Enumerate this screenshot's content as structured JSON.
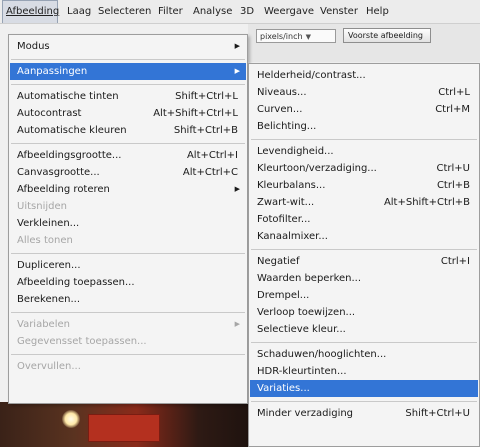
{
  "menubar": [
    {
      "label": "Afbeelding",
      "active": true
    },
    {
      "label": "Laag"
    },
    {
      "label": "Selecteren"
    },
    {
      "label": "Filter"
    },
    {
      "label": "Analyse"
    },
    {
      "label": "3D"
    },
    {
      "label": "Weergave"
    },
    {
      "label": "Venster"
    },
    {
      "label": "Help"
    }
  ],
  "toolbar": {
    "unit_field": "pixels/inch",
    "front_image_button": "Voorste afbeelding"
  },
  "main_menu": [
    {
      "label": "Modus",
      "submenu": true
    },
    {
      "separator": true
    },
    {
      "label": "Aanpassingen",
      "submenu": true,
      "highlighted": true
    },
    {
      "separator": true
    },
    {
      "label": "Automatische tinten",
      "shortcut": "Shift+Ctrl+L"
    },
    {
      "label": "Autocontrast",
      "shortcut": "Alt+Shift+Ctrl+L"
    },
    {
      "label": "Automatische kleuren",
      "shortcut": "Shift+Ctrl+B"
    },
    {
      "separator": true
    },
    {
      "label": "Afbeeldingsgrootte...",
      "shortcut": "Alt+Ctrl+I"
    },
    {
      "label": "Canvasgrootte...",
      "shortcut": "Alt+Ctrl+C"
    },
    {
      "label": "Afbeelding roteren",
      "submenu": true
    },
    {
      "label": "Uitsnijden",
      "disabled": true
    },
    {
      "label": "Verkleinen..."
    },
    {
      "label": "Alles tonen",
      "disabled": true
    },
    {
      "separator": true
    },
    {
      "label": "Dupliceren..."
    },
    {
      "label": "Afbeelding toepassen..."
    },
    {
      "label": "Berekenen..."
    },
    {
      "separator": true
    },
    {
      "label": "Variabelen",
      "submenu": true,
      "disabled": true
    },
    {
      "label": "Gegevensset toepassen...",
      "disabled": true
    },
    {
      "separator": true
    },
    {
      "label": "Overvullen...",
      "disabled": true
    }
  ],
  "submenu": [
    {
      "label": "Helderheid/contrast..."
    },
    {
      "label": "Niveaus...",
      "shortcut": "Ctrl+L"
    },
    {
      "label": "Curven...",
      "shortcut": "Ctrl+M"
    },
    {
      "label": "Belichting..."
    },
    {
      "separator": true
    },
    {
      "label": "Levendigheid..."
    },
    {
      "label": "Kleurtoon/verzadiging...",
      "shortcut": "Ctrl+U"
    },
    {
      "label": "Kleurbalans...",
      "shortcut": "Ctrl+B"
    },
    {
      "label": "Zwart-wit...",
      "shortcut": "Alt+Shift+Ctrl+B"
    },
    {
      "label": "Fotofilter..."
    },
    {
      "label": "Kanaalmixer..."
    },
    {
      "separator": true
    },
    {
      "label": "Negatief",
      "shortcut": "Ctrl+I"
    },
    {
      "label": "Waarden beperken..."
    },
    {
      "label": "Drempel..."
    },
    {
      "label": "Verloop toewijzen..."
    },
    {
      "label": "Selectieve kleur..."
    },
    {
      "separator": true
    },
    {
      "label": "Schaduwen/hooglichten..."
    },
    {
      "label": "HDR-kleurtinten..."
    },
    {
      "label": "Variaties...",
      "highlighted": true
    },
    {
      "separator": true
    },
    {
      "label": "Minder verzadiging",
      "shortcut": "Shift+Ctrl+U"
    }
  ],
  "colors": {
    "highlight": "#3375d6",
    "menu_bg": "#f4f4f4",
    "disabled_text": "#a6a6a6"
  }
}
